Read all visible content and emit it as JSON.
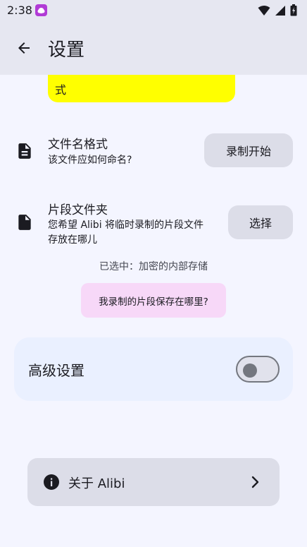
{
  "status_bar": {
    "time": "2:38",
    "icons": [
      "app-notification-icon",
      "wifi-icon",
      "cell-signal-icon",
      "battery-icon"
    ]
  },
  "app_bar": {
    "title": "设置",
    "back_icon": "arrow-back-icon"
  },
  "partial_chip": {
    "text": "式",
    "color": "#ffff00"
  },
  "filename_setting": {
    "icon": "document-icon",
    "title": "文件名格式",
    "description": "该文件应如何命名?",
    "button_label": "录制开始"
  },
  "folder_setting": {
    "icon": "file-icon",
    "title": "片段文件夹",
    "description_line1": "您希望 Alibi 将临时录制的片段文件",
    "description_line2": "存放在哪儿",
    "button_label": "选择",
    "selected_text": "已选中：加密的内部存储"
  },
  "help_chip": {
    "text": "我录制的片段保存在哪里?",
    "color": "#f7d8f8"
  },
  "advanced": {
    "label": "高级设置",
    "toggle_on": false
  },
  "about": {
    "icon": "info-icon",
    "label": "关于 Alibi",
    "chevron": "chevron-right-icon"
  },
  "colors": {
    "background": "#f4f5ff",
    "app_bar": "#e6e7f1",
    "button": "#dcdde8",
    "card": "#eaf0ff"
  }
}
